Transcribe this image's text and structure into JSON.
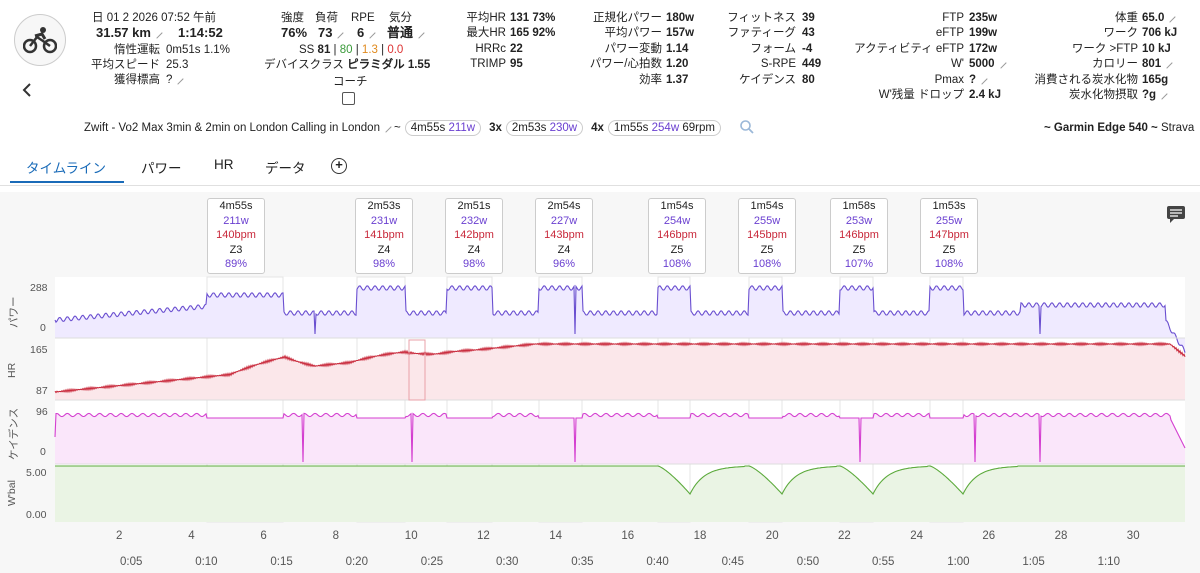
{
  "header": {
    "date": "日 01 2 2026",
    "time": "07:52 午前",
    "distance": "31.57 km",
    "duration": "1:14:52",
    "coast_label": "惰性運転",
    "coast_value": "0m51s 1.1%",
    "avg_speed_label": "平均スピード",
    "avg_speed_value": "25.3",
    "elev_label": "獲得標高",
    "elev_value": "?",
    "intensity_label": "強度",
    "intensity_value": "76%",
    "load_label": "負荷",
    "load_value": "73",
    "rpe_label": "RPE",
    "rpe_value": "6",
    "mood_label": "気分",
    "mood_value": "普通",
    "ss_label": "SS",
    "ss_value": "81",
    "ss_a": "80",
    "ss_b": "1.3",
    "ss_c": "0.0",
    "device_class_label": "デバイスクラス",
    "device_class_value": "ピラミダル",
    "device_class_num": "1.55",
    "coach_label": "コーチ",
    "avg_hr_label": "平均HR",
    "avg_hr_value": "131 73%",
    "max_hr_label": "最大HR",
    "max_hr_value": "165 92%",
    "hrrc_label": "HRRc",
    "hrrc_value": "22",
    "trimp_label": "TRIMP",
    "trimp_value": "95",
    "np_label": "正規化パワー",
    "np_value": "180w",
    "avgp_label": "平均パワー",
    "avgp_value": "157w",
    "pv_label": "パワー変動",
    "pv_value": "1.14",
    "phr_label": "パワー/心拍数",
    "phr_value": "1.20",
    "eff_label": "効率",
    "eff_value": "1.37",
    "fit_label": "フィットネス",
    "fit_value": "39",
    "fat_label": "ファティーグ",
    "fat_value": "43",
    "form_label": "フォーム",
    "form_value": "-4",
    "srpe_label": "S-RPE",
    "srpe_value": "449",
    "cad_label": "ケイデンス",
    "cad_value": "80",
    "ftp_label": "FTP",
    "ftp_value": "235w",
    "eftp_label": "eFTP",
    "eftp_value": "199w",
    "aeftp_label": "アクティビティ eFTP",
    "aeftp_value": "172w",
    "wp_label": "W'",
    "wp_value": "5000",
    "pmax_label": "Pmax",
    "pmax_value": "?",
    "wbal_drop_label": "W'残量 ドロップ",
    "wbal_drop_value": "2.4 kJ",
    "weight_label": "体重",
    "weight_value": "65.0",
    "work_label": "ワーク",
    "work_value": "706 kJ",
    "work_ftp_label": "ワーク >FTP",
    "work_ftp_value": "10 kJ",
    "cal_label": "カロリー",
    "cal_value": "801",
    "carb_used_label": "消費される炭水化物",
    "carb_used_value": "165g",
    "carb_in_label": "炭水化物摂取",
    "carb_in_value": "?g"
  },
  "title_row": {
    "name": "Zwift - Vo2 Max 3min & 2min on London Calling in London",
    "tilde": "~",
    "chip1_dur": "4m55s",
    "chip1_pw": "211w",
    "chip2_count": "3x",
    "chip2_dur": "2m53s",
    "chip2_pw": "230w",
    "chip3_count": "4x",
    "chip3_dur": "1m55s",
    "chip3_pw": "254w",
    "chip3_cad": "69rpm",
    "device": "~ Garmin Edge 540 ~",
    "source": "Strava"
  },
  "tabs": [
    {
      "label": "タイムライン"
    },
    {
      "label": "パワー"
    },
    {
      "label": "HR"
    },
    {
      "label": "データ"
    }
  ],
  "intervals": [
    {
      "dur": "4m55s",
      "pw": "211w",
      "hr": "140bpm",
      "zone": "Z3",
      "pct": "89%"
    },
    {
      "dur": "2m53s",
      "pw": "231w",
      "hr": "141bpm",
      "zone": "Z4",
      "pct": "98%"
    },
    {
      "dur": "2m51s",
      "pw": "232w",
      "hr": "142bpm",
      "zone": "Z4",
      "pct": "98%"
    },
    {
      "dur": "2m54s",
      "pw": "227w",
      "hr": "143bpm",
      "zone": "Z4",
      "pct": "96%"
    },
    {
      "dur": "1m54s",
      "pw": "254w",
      "hr": "146bpm",
      "zone": "Z5",
      "pct": "108%"
    },
    {
      "dur": "1m54s",
      "pw": "255w",
      "hr": "145bpm",
      "zone": "Z5",
      "pct": "108%"
    },
    {
      "dur": "1m58s",
      "pw": "253w",
      "hr": "146bpm",
      "zone": "Z5",
      "pct": "107%"
    },
    {
      "dur": "1m53s",
      "pw": "255w",
      "hr": "147bpm",
      "zone": "Z5",
      "pct": "108%"
    }
  ],
  "chart_labels": {
    "power": "パワー",
    "power_max": "288",
    "power_min": "0",
    "hr": "HR",
    "hr_max": "165",
    "hr_min": "87",
    "cad": "ケイデンス",
    "cad_max": "96",
    "cad_min": "0",
    "wbal": "W'bal",
    "wbal_max": "5.00",
    "wbal_min": "0.00"
  },
  "lap_numbers": [
    "2",
    "4",
    "6",
    "8",
    "10",
    "12",
    "14",
    "16",
    "18",
    "20",
    "22",
    "24",
    "26",
    "28",
    "30"
  ],
  "time_ticks": [
    "0:05",
    "0:10",
    "0:15",
    "0:20",
    "0:25",
    "0:30",
    "0:35",
    "0:40",
    "0:45",
    "0:50",
    "0:55",
    "1:00",
    "1:05",
    "1:10"
  ],
  "colors": {
    "power": "#6a4fd0",
    "hr": "#c8283a",
    "cad": "#d43fd0",
    "wbal": "#5caa3c"
  }
}
